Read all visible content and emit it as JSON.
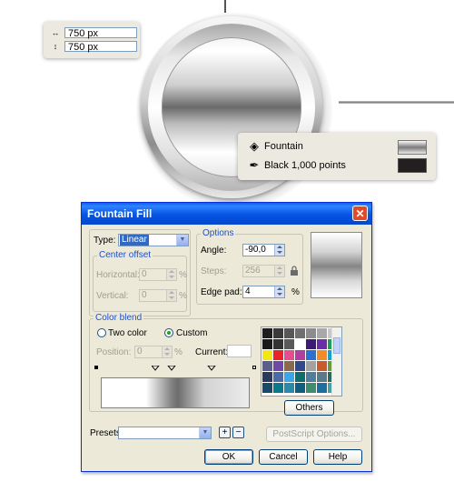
{
  "size_box": {
    "width": "750 px",
    "height": "750 px"
  },
  "fill_info": {
    "fill_type": "Fountain",
    "outline": "Black  1,000 points",
    "outline_color": "#231f20"
  },
  "dialog": {
    "title": "Fountain Fill",
    "close": "✕",
    "type_label": "Type:",
    "type_value": "Linear",
    "center_offset": {
      "legend": "Center offset",
      "horizontal_label": "Horizontal:",
      "horizontal_value": "0",
      "vertical_label": "Vertical:",
      "vertical_value": "0",
      "unit": "%"
    },
    "options": {
      "legend": "Options",
      "angle_label": "Angle:",
      "angle_value": "-90,0",
      "steps_label": "Steps:",
      "steps_value": "256",
      "edge_pad_label": "Edge pad:",
      "edge_pad_value": "4",
      "unit": "%"
    },
    "color_blend": {
      "legend": "Color blend",
      "two_color_label": "Two color",
      "custom_label": "Custom",
      "selected": "Custom",
      "position_label": "Position:",
      "position_value": "0",
      "position_unit": "%",
      "current_label": "Current:",
      "current_color": "#ffffff",
      "others_label": "Others",
      "palette": [
        "#1e1e1e",
        "#3a3a3a",
        "#575757",
        "#707070",
        "#8c8c8c",
        "#a8a8a8",
        "#c8c8c8",
        "#1a1a1a",
        "#333333",
        "#5a5a5a",
        "#ffffff",
        "#3d1a78",
        "#6b2da8",
        "#1b9e5a",
        "#f4e610",
        "#e8242a",
        "#e44d8e",
        "#b23fa0",
        "#2e6fd1",
        "#f28c28",
        "#14a4c8",
        "#5b5f8e",
        "#6e4aa6",
        "#8b6a4c",
        "#2e4a8a",
        "#a2a2a2",
        "#c75c2a",
        "#6e9a3a",
        "#2a3a5a",
        "#4a6aa8",
        "#3aa8e8",
        "#0e6e6e",
        "#4e7e9e",
        "#5a7a8a",
        "#2a6a5a",
        "#1a4a6a",
        "#0a7a8a",
        "#2a8aaa",
        "#0e5e7e",
        "#3e8e6e",
        "#1e6e9e",
        "#4aa0a0"
      ]
    },
    "presets_label": "Presets:",
    "presets_value": "",
    "add_preset": "+",
    "remove_preset": "−",
    "postscript_label": "PostScript Options...",
    "ok_label": "OK",
    "cancel_label": "Cancel",
    "help_label": "Help"
  }
}
